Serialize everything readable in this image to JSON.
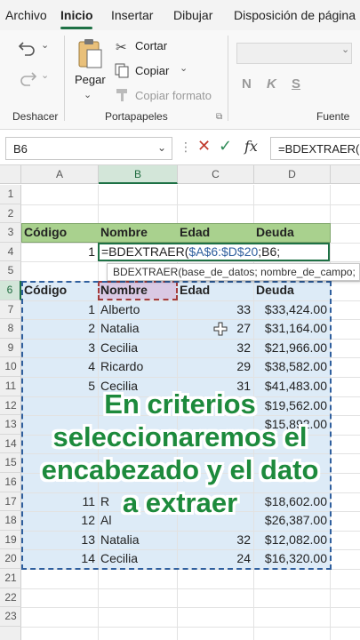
{
  "tabs": [
    {
      "label": "Archivo"
    },
    {
      "label": "Inicio"
    },
    {
      "label": "Insertar"
    },
    {
      "label": "Dibujar"
    },
    {
      "label": "Disposición de página"
    }
  ],
  "ribbon": {
    "undo_group_label": "Deshacer",
    "clipboard_group_label": "Portapapeles",
    "font_group_label": "Fuente",
    "paste_label": "Pegar",
    "cut_label": "Cortar",
    "copy_label": "Copiar",
    "format_painter_label": "Copiar formato",
    "bold_label": "N",
    "italic_label": "K",
    "underline_label": "S"
  },
  "formula_bar": {
    "name_box": "B6",
    "dots": "⋮",
    "cancel": "✕",
    "confirm": "✓",
    "fx": "fx",
    "formula": "=BDEXTRAER("
  },
  "columns": [
    "A",
    "B",
    "C",
    "D"
  ],
  "rows": [
    "1",
    "2",
    "3",
    "4",
    "5",
    "6",
    "7",
    "8",
    "9",
    "10",
    "11",
    "12",
    "13",
    "14",
    "15",
    "16",
    "17",
    "18",
    "19",
    "20",
    "21",
    "22",
    "23"
  ],
  "criteria": {
    "headers": [
      "Código",
      "Nombre",
      "Edad",
      "Deuda"
    ],
    "a4": "1",
    "b4_prefix": "=BDEXTRAER(",
    "b4_range": "$A$6:$D$20",
    "b4_suffix": ";B6;"
  },
  "tooltip": {
    "text": "BDEXTRAER(base_de_datos; nombre_de_campo; "
  },
  "database": {
    "headers": [
      "Código",
      "Nombre",
      "Edad",
      "Deuda"
    ],
    "rows": [
      {
        "row": 7,
        "code": "1",
        "name": "Alberto",
        "age": "33",
        "debt": "$33,424.00"
      },
      {
        "row": 8,
        "code": "2",
        "name": "Natalia",
        "age": "27",
        "debt": "$31,164.00"
      },
      {
        "row": 9,
        "code": "3",
        "name": "Cecilia",
        "age": "32",
        "debt": "$21,966.00"
      },
      {
        "row": 10,
        "code": "4",
        "name": "Ricardo",
        "age": "29",
        "debt": "$38,582.00"
      },
      {
        "row": 11,
        "code": "5",
        "name": "Cecilia",
        "age": "31",
        "debt": "$41,483.00"
      },
      {
        "row": 12,
        "code": "",
        "name": "",
        "age": "",
        "debt": "$19,562.00"
      },
      {
        "row": 13,
        "code": "",
        "name": "",
        "age": "",
        "debt": "$15,892.00"
      },
      {
        "row": 17,
        "code": "11",
        "name": "R",
        "age": "",
        "debt": "$18,602.00"
      },
      {
        "row": 18,
        "code": "12",
        "name": "Al",
        "age": "",
        "debt": "$26,387.00"
      },
      {
        "row": 19,
        "code": "13",
        "name": "Natalia",
        "age": "32",
        "debt": "$12,082.00"
      },
      {
        "row": 20,
        "code": "14",
        "name": "Cecilia",
        "age": "24",
        "debt": "$16,320.00"
      }
    ]
  },
  "overlay": {
    "line1": "En criterios",
    "line2": "seleccionaremos el",
    "line3": "encabezado y el dato",
    "line4": "a extraer"
  },
  "colors": {
    "accent": "#1e7145",
    "header_band": "#a9d18e",
    "db_fill": "#ddebf7",
    "overlay_text": "#1d8a3c"
  }
}
